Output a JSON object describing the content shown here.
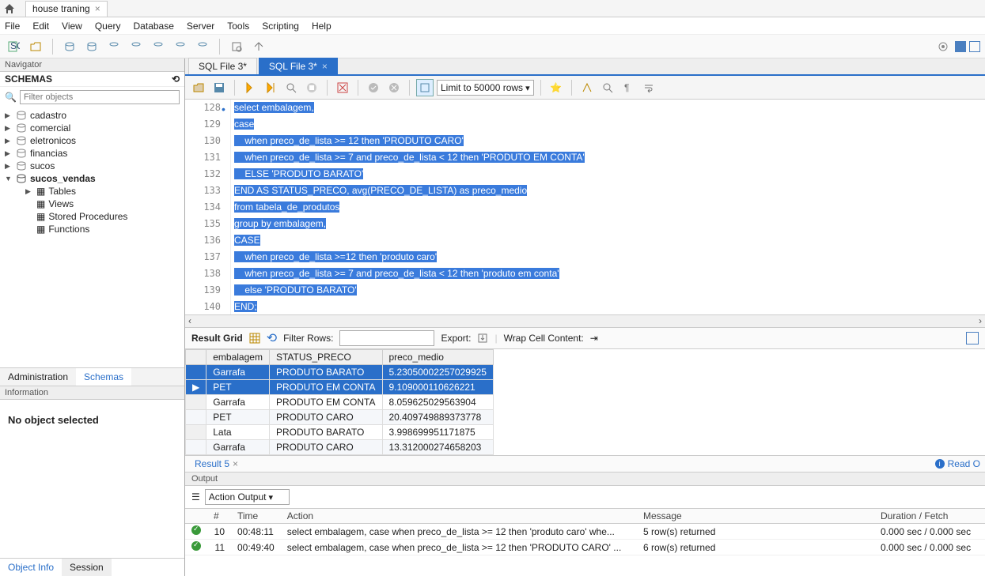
{
  "title_tab": "house traning",
  "menu": [
    "File",
    "Edit",
    "View",
    "Query",
    "Database",
    "Server",
    "Tools",
    "Scripting",
    "Help"
  ],
  "navigator": {
    "label": "Navigator",
    "schemas_label": "SCHEMAS",
    "filter_placeholder": "Filter objects",
    "tree": [
      {
        "name": "cadastro",
        "bold": false
      },
      {
        "name": "comercial",
        "bold": false
      },
      {
        "name": "eletronicos",
        "bold": false
      },
      {
        "name": "financias",
        "bold": false
      },
      {
        "name": "sucos",
        "bold": false
      },
      {
        "name": "sucos_vendas",
        "bold": true,
        "expanded": true,
        "children": [
          "Tables",
          "Views",
          "Stored Procedures",
          "Functions"
        ]
      }
    ],
    "tabs": [
      "Administration",
      "Schemas"
    ],
    "active_tab": "Schemas",
    "info_label": "Information",
    "info_body": "No object selected",
    "info_tabs": [
      "Object Info",
      "Session"
    ],
    "info_active": "Object Info"
  },
  "file_tabs": [
    {
      "label": "SQL File 3*",
      "active": false
    },
    {
      "label": "SQL File 3*",
      "active": true
    }
  ],
  "limit_label": "Limit to 50000 rows",
  "lines": [
    128,
    129,
    130,
    131,
    132,
    133,
    134,
    135,
    136,
    137,
    138,
    139,
    140
  ],
  "code": [
    "select embalagem,",
    "case",
    "    when preco_de_lista >= 12 then 'PRODUTO CARO'",
    "    when preco_de_lista >= 7 and preco_de_lista < 12 then 'PRODUTO EM CONTA'",
    "    ELSE 'PRODUTO BARATO'",
    "END AS STATUS_PRECO, avg(PRECO_DE_LISTA) as preco_medio",
    "from tabela_de_produtos",
    "group by embalagem,",
    "CASE",
    "    when preco_de_lista >=12 then 'produto caro'",
    "    when preco_de_lista >= 7 and preco_de_lista < 12 then 'produto em conta'",
    "    else 'PRODUTO BARATO'",
    "END;"
  ],
  "result_toolbar": {
    "grid_label": "Result Grid",
    "filter_label": "Filter Rows:",
    "export_label": "Export:",
    "wrap_label": "Wrap Cell Content:"
  },
  "grid": {
    "cols": [
      "embalagem",
      "STATUS_PRECO",
      "preco_medio"
    ],
    "rows": [
      [
        "Garrafa",
        "PRODUTO BARATO",
        "5.23050002257029925"
      ],
      [
        "PET",
        "PRODUTO EM CONTA",
        "9.109000110626221"
      ],
      [
        "Garrafa",
        "PRODUTO EM CONTA",
        "8.059625029563904"
      ],
      [
        "PET",
        "PRODUTO CARO",
        "20.409749889373778"
      ],
      [
        "Lata",
        "PRODUTO BARATO",
        "3.998699951171875"
      ],
      [
        "Garrafa",
        "PRODUTO CARO",
        "13.312000274658203"
      ]
    ],
    "selected": [
      0,
      1
    ]
  },
  "result_tab_label": "Result 5",
  "readonly_label": "Read O",
  "output_label": "Output",
  "output_select": "Action Output",
  "output_cols": [
    "",
    "#",
    "Time",
    "Action",
    "Message",
    "Duration / Fetch"
  ],
  "output_rows": [
    {
      "n": "10",
      "time": "00:48:11",
      "action": "select embalagem,  case when preco_de_lista >= 12 then 'produto caro'    whe...",
      "msg": "5 row(s) returned",
      "dur": "0.000 sec / 0.000 sec"
    },
    {
      "n": "11",
      "time": "00:49:40",
      "action": "select embalagem, case when preco_de_lista >= 12 then 'PRODUTO CARO'  ...",
      "msg": "6 row(s) returned",
      "dur": "0.000 sec / 0.000 sec"
    }
  ]
}
